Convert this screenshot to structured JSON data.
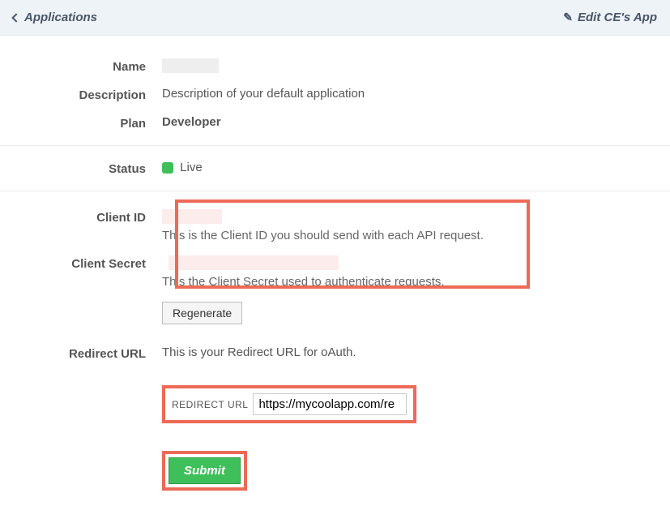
{
  "header": {
    "breadcrumb": "Applications",
    "edit_link": "Edit CE's App"
  },
  "fields": {
    "name_label": "Name",
    "description_label": "Description",
    "description_value": "Description of your default application",
    "plan_label": "Plan",
    "plan_value": "Developer",
    "status_label": "Status",
    "status_value": "Live",
    "client_id_label": "Client ID",
    "client_id_help": "This is the Client ID you should send with each API request.",
    "client_secret_label": "Client Secret",
    "client_secret_help": "This the Client Secret used to authenticate requests.",
    "regenerate_label": "Regenerate",
    "redirect_url_label": "Redirect URL",
    "redirect_url_help": "This is your Redirect URL for oAuth.",
    "redirect_input_label": "REDIRECT URL",
    "redirect_input_value": "https://mycoolapp.com/re",
    "submit_label": "Submit"
  }
}
